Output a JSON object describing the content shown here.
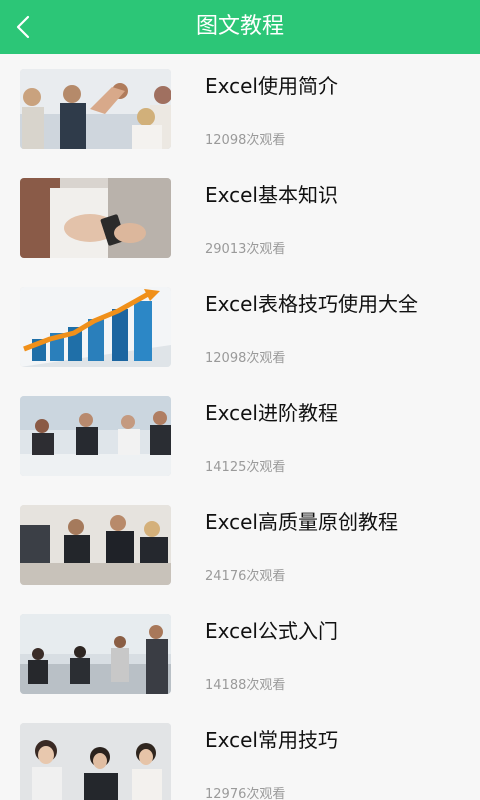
{
  "header": {
    "title": "图文教程",
    "back_icon": "chevron-left-icon",
    "color": "#2cc677"
  },
  "items": [
    {
      "title": "Excel使用简介",
      "views": "12098次观看",
      "image": "team-high-five-photo"
    },
    {
      "title": "Excel基本知识",
      "views": "29013次观看",
      "image": "smartphone-hands-photo"
    },
    {
      "title": "Excel表格技巧使用大全",
      "views": "12098次观看",
      "image": "rising-bar-chart-photo"
    },
    {
      "title": "Excel进阶教程",
      "views": "14125次观看",
      "image": "meeting-applause-photo"
    },
    {
      "title": "Excel高质量原创教程",
      "views": "24176次观看",
      "image": "business-meeting-photo"
    },
    {
      "title": "Excel公式入门",
      "views": "14188次观看",
      "image": "office-presentation-photo"
    },
    {
      "title": "Excel常用技巧",
      "views": "12976次观看",
      "image": "smiling-team-photo"
    }
  ]
}
